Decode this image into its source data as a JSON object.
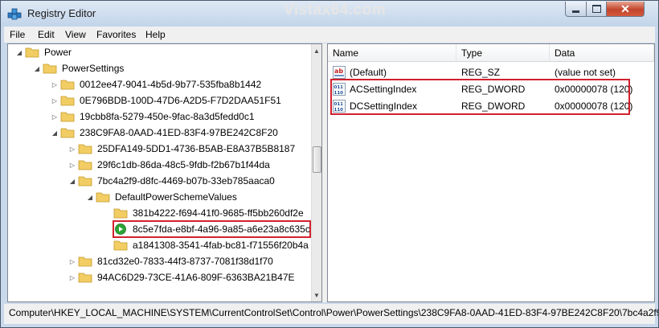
{
  "window": {
    "title": "Registry Editor",
    "watermark": "Vistax64.com",
    "close_glyph": "✕"
  },
  "menu": {
    "items": [
      {
        "label": "File"
      },
      {
        "label": "Edit"
      },
      {
        "label": "View"
      },
      {
        "label": "Favorites"
      },
      {
        "label": "Help"
      }
    ]
  },
  "tree": {
    "nodes": [
      {
        "label": "Power",
        "expanded": true,
        "icon": "folder-icon"
      },
      {
        "label": "PowerSettings",
        "expanded": true,
        "icon": "folder-icon"
      },
      {
        "label": "0012ee47-9041-4b5d-9b77-535fba8b1442",
        "expanded": false,
        "icon": "folder-icon"
      },
      {
        "label": "0E796BDB-100D-47D6-A2D5-F7D2DAA51F51",
        "expanded": false,
        "icon": "folder-icon"
      },
      {
        "label": "19cbb8fa-5279-450e-9fac-8a3d5fedd0c1",
        "expanded": false,
        "icon": "folder-icon"
      },
      {
        "label": "238C9FA8-0AAD-41ED-83F4-97BE242C8F20",
        "expanded": true,
        "icon": "folder-icon"
      },
      {
        "label": "25DFA149-5DD1-4736-B5AB-E8A37B5B8187",
        "expanded": false,
        "icon": "folder-icon"
      },
      {
        "label": "29f6c1db-86da-48c5-9fdb-f2b67b1f44da",
        "expanded": false,
        "icon": "folder-icon"
      },
      {
        "label": "7bc4a2f9-d8fc-4469-b07b-33eb785aaca0",
        "expanded": true,
        "icon": "folder-icon"
      },
      {
        "label": "DefaultPowerSchemeValues",
        "expanded": true,
        "icon": "folder-icon"
      },
      {
        "label": "381b4222-f694-41f0-9685-ff5bb260df2e",
        "icon": "folder-icon"
      },
      {
        "label": "8c5e7fda-e8bf-4a96-9a85-a6e23a8c635c",
        "icon": "green-play-icon",
        "selected": true
      },
      {
        "label": "a1841308-3541-4fab-bc81-f71556f20b4a",
        "icon": "folder-icon"
      },
      {
        "label": "81cd32e0-7833-44f3-8737-7081f38d1f70",
        "expanded": false,
        "icon": "folder-icon"
      },
      {
        "label": "94AC6D29-73CE-41A6-809F-6363BA21B47E",
        "expanded": false,
        "icon": "folder-icon"
      }
    ]
  },
  "list": {
    "columns": [
      {
        "label": "Name"
      },
      {
        "label": "Type"
      },
      {
        "label": "Data"
      }
    ],
    "rows": [
      {
        "name": "(Default)",
        "type": "REG_SZ",
        "data": "(value not set)",
        "icon": "string-value-icon",
        "icon_text": "ab"
      },
      {
        "name": "ACSettingIndex",
        "type": "REG_DWORD",
        "data": "0x00000078 (120)",
        "icon": "binary-value-icon",
        "icon_text": "011 110"
      },
      {
        "name": "DCSettingIndex",
        "type": "REG_DWORD",
        "data": "0x00000078 (120)",
        "icon": "binary-value-icon",
        "icon_text": "011 110"
      }
    ]
  },
  "status": {
    "path": "Computer\\HKEY_LOCAL_MACHINE\\SYSTEM\\CurrentControlSet\\Control\\Power\\PowerSettings\\238C9FA8-0AAD-41ED-83F4-97BE242C8F20\\7bc4a2f9"
  },
  "colors": {
    "highlight_border": "#d2212e",
    "folder": "#f2cd64",
    "selection_play": "#2da436"
  }
}
